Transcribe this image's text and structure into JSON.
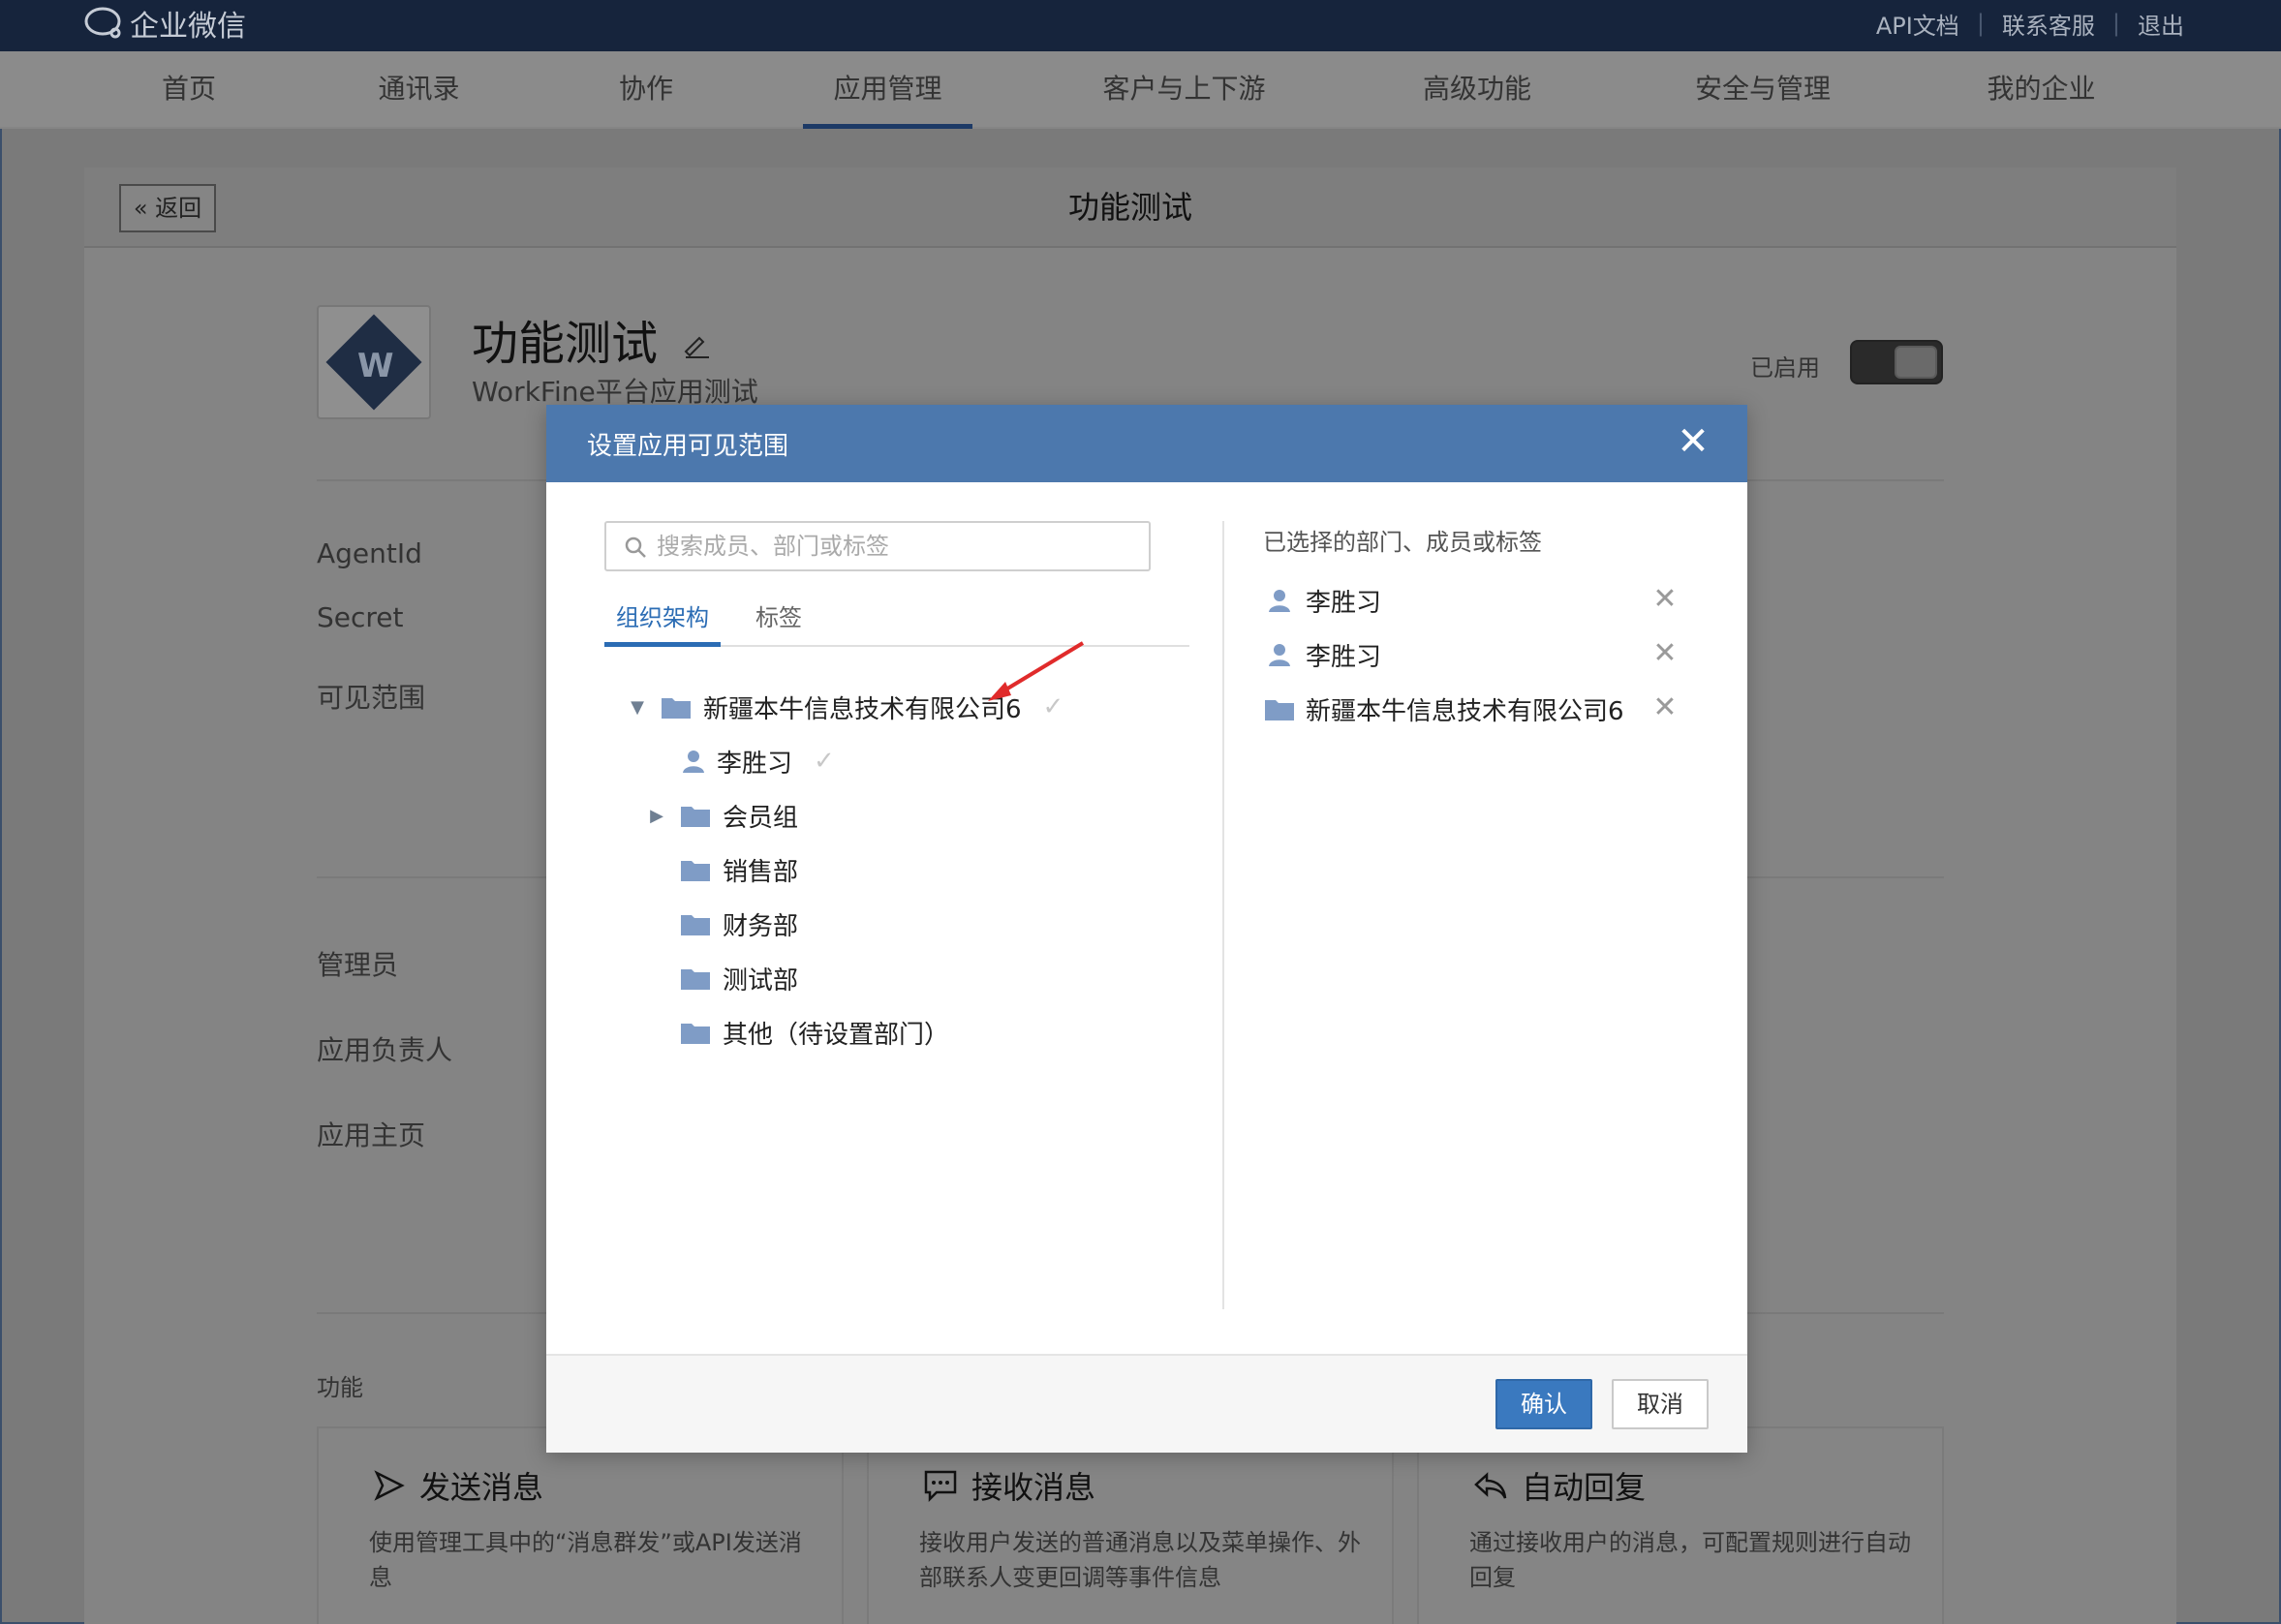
{
  "topbar": {
    "brand": "企业微信",
    "links": [
      "API文档",
      "联系客服",
      "退出"
    ]
  },
  "nav": {
    "items": [
      "首页",
      "通讯录",
      "协作",
      "应用管理",
      "客户与上下游",
      "高级功能",
      "安全与管理",
      "我的企业"
    ],
    "active": "应用管理"
  },
  "page": {
    "back_label": "« 返回",
    "title": "功能测试",
    "app_name": "功能测试",
    "app_desc": "WorkFine平台应用测试",
    "enabled_label": "已启用",
    "fields": [
      "AgentId",
      "Secret",
      "可见范围",
      "管理员",
      "应用负责人",
      "应用主页"
    ],
    "func_section": "功能",
    "functions": [
      {
        "name": "发送消息",
        "desc": "使用管理工具中的“消息群发”或API发送消息"
      },
      {
        "name": "接收消息",
        "desc": "接收用户发送的普通消息以及菜单操作、外部联系人变更回调等事件信息"
      },
      {
        "name": "自动回复",
        "desc": "通过接收用户的消息，可配置规则进行自动回复"
      }
    ]
  },
  "modal": {
    "title": "设置应用可见范围",
    "search_placeholder": "搜索成员、部门或标签",
    "tabs": [
      "组织架构",
      "标签"
    ],
    "tree": [
      {
        "label": "新疆本牛信息技术有限公司6",
        "type": "folder",
        "expanded": true,
        "checked": true
      },
      {
        "label": "李胜习",
        "type": "user",
        "checked": true
      },
      {
        "label": "会员组",
        "type": "folder",
        "expandable": true
      },
      {
        "label": "销售部",
        "type": "folder"
      },
      {
        "label": "财务部",
        "type": "folder"
      },
      {
        "label": "测试部",
        "type": "folder"
      },
      {
        "label": "其他（待设置部门）",
        "type": "folder"
      }
    ],
    "selected_title": "已选择的部门、成员或标签",
    "selected": [
      {
        "label": "李胜习",
        "type": "user"
      },
      {
        "label": "李胜习",
        "type": "user"
      },
      {
        "label": "新疆本牛信息技术有限公司6",
        "type": "folder"
      }
    ],
    "confirm": "确认",
    "cancel": "取消"
  },
  "colors": {
    "topbar": "#16243c",
    "modal_header": "#4c78ad",
    "primary_button": "#3a79bf",
    "tab_active": "#2b6cb4",
    "folder_icon": "#7f9cc6",
    "arrow": "#e02b2b"
  }
}
